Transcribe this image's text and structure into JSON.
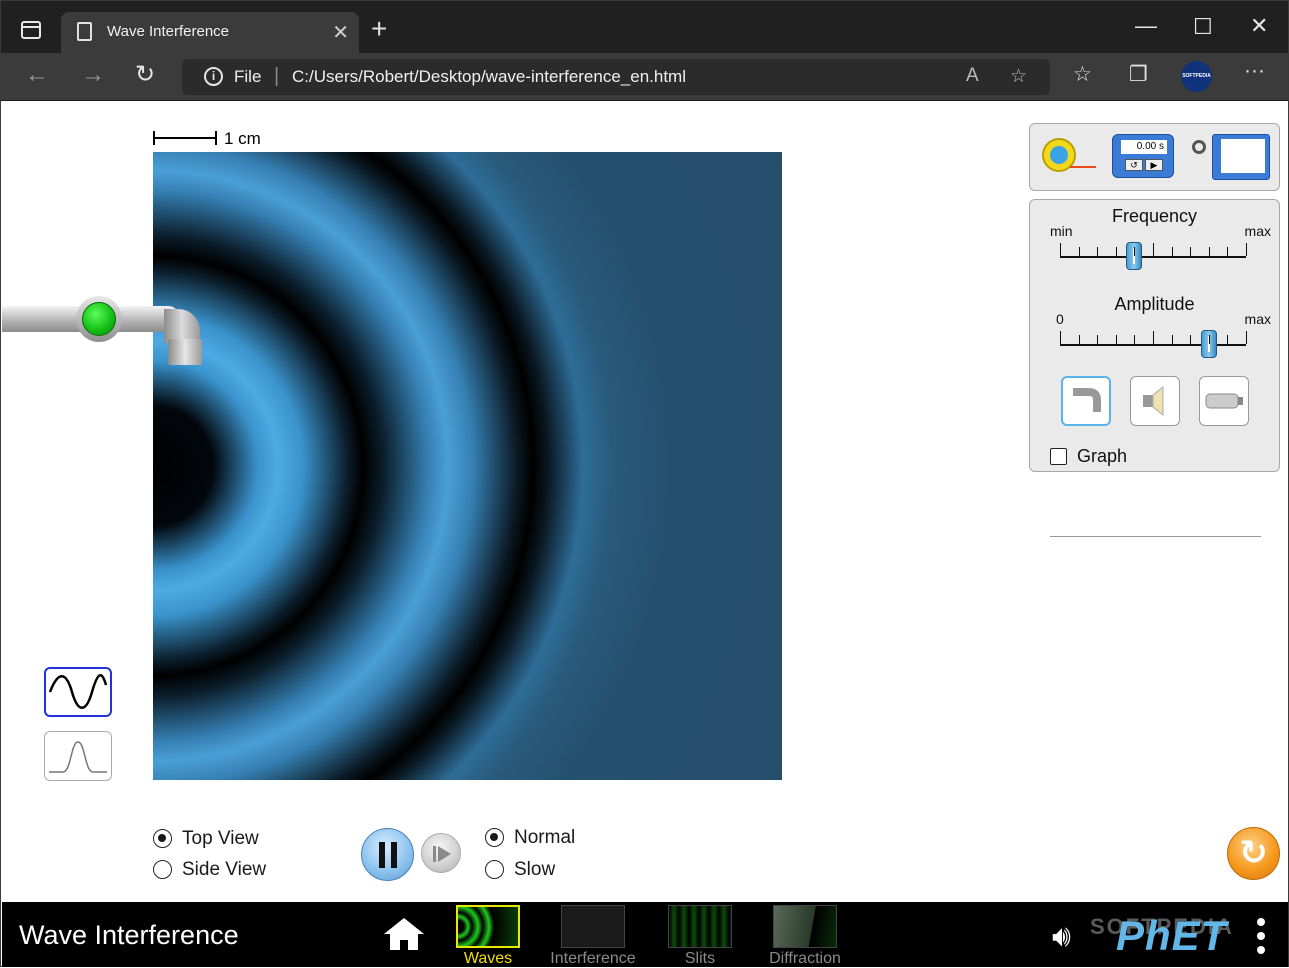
{
  "browser": {
    "tab_title": "Wave Interference",
    "address_scheme": "File",
    "address_url": "C:/Users/Robert/Desktop/wave-interference_en.html",
    "profile_label": "SOFTPEDIA"
  },
  "sim": {
    "scale_label": "1 cm",
    "view_options": [
      {
        "label": "Top View",
        "selected": true
      },
      {
        "label": "Side View",
        "selected": false
      }
    ],
    "speed_options": [
      {
        "label": "Normal",
        "selected": true
      },
      {
        "label": "Slow",
        "selected": false
      }
    ],
    "stopwatch_display": "0.00 s",
    "frequency": {
      "title": "Frequency",
      "min_label": "min",
      "max_label": "max",
      "value_fraction": 0.4
    },
    "amplitude": {
      "title": "Amplitude",
      "min_label": "0",
      "max_label": "max",
      "value_fraction": 0.8
    },
    "graph_label": "Graph",
    "graph_checked": false,
    "source_buttons": [
      "water-faucet",
      "sound-speaker",
      "light-laser"
    ],
    "selected_source": "water-faucet",
    "colors": {
      "wave_blue": "#4fa9e2",
      "background_water": "#254c68",
      "faucet_green": "#16c016",
      "reset_orange": "#f59a1f",
      "active_tab": "#f0e000"
    }
  },
  "navbar": {
    "title": "Wave Interference",
    "screens": [
      {
        "label": "Waves",
        "active": true
      },
      {
        "label": "Interference",
        "active": false
      },
      {
        "label": "Slits",
        "active": false
      },
      {
        "label": "Diffraction",
        "active": false
      }
    ],
    "brand": "PhET",
    "watermark": "SOFTPEDIA"
  }
}
